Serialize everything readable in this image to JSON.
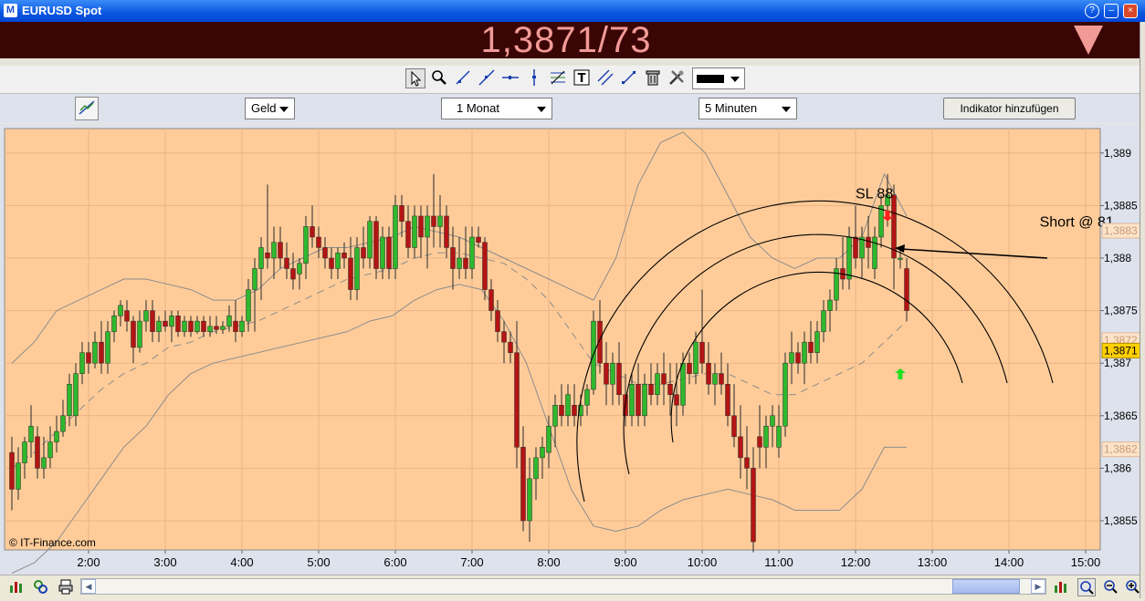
{
  "window": {
    "app_icon": "M",
    "title": "EURUSD Spot",
    "help_icon": "?",
    "minimize_icon": "–",
    "close_icon": "×"
  },
  "price": {
    "value": "1,3871/73",
    "direction": "down",
    "color": "#f19a96",
    "background": "#3a0505"
  },
  "toolbar": {
    "tools": [
      "select-pointer-icon",
      "zoom-icon",
      "trend-line-icon",
      "line-icon",
      "horizontal-line-icon",
      "vertical-line-icon",
      "fibonacci-icon",
      "text-icon",
      "parallel-lines-icon",
      "channel-icon",
      "trash-icon",
      "tools-icon"
    ],
    "color": "#000000"
  },
  "controls": {
    "price_type": "Geld",
    "period": "1 Monat",
    "interval": "5 Minuten",
    "add_indicator": "Indikator hinzufügen"
  },
  "chart_data": {
    "type": "candlestick",
    "background": "#ffcc99",
    "x_ticks": [
      "2:00",
      "3:00",
      "4:00",
      "5:00",
      "6:00",
      "7:00",
      "8:00",
      "9:00",
      "10:00",
      "11:00",
      "12:00",
      "13:00",
      "14:00",
      "15:00"
    ],
    "y_ticks": [
      "1,389",
      "1,3885",
      "1,388",
      "1,3875",
      "1,387",
      "1,3865",
      "1,386",
      "1,3855"
    ],
    "ylim": [
      1.3852,
      1.3894
    ],
    "price_tags": [
      {
        "label": "1,3883",
        "value": 1.38826,
        "style": "faded"
      },
      {
        "label": "1,3872",
        "value": 1.38722,
        "style": "faded"
      },
      {
        "label": "1,3871",
        "value": 1.38712,
        "style": "current"
      },
      {
        "label": "1,3862",
        "value": 1.38618,
        "style": "faded"
      }
    ],
    "annotations": [
      {
        "text": "SL 88",
        "x": "12:00",
        "y": 1.38857
      },
      {
        "text": "Short @ 81",
        "x": "14:24",
        "y": 1.3883
      }
    ],
    "copyright": "© IT-Finance.com",
    "bullish_color": "#2eb82e",
    "bearish_color": "#b41414",
    "candles": [
      [
        1.38615,
        1.3863,
        1.3856,
        1.3858
      ],
      [
        1.3858,
        1.3862,
        1.3857,
        1.38605
      ],
      [
        1.38605,
        1.3863,
        1.3859,
        1.38625
      ],
      [
        1.38625,
        1.3866,
        1.3861,
        1.3864
      ],
      [
        1.3863,
        1.3864,
        1.3859,
        1.386
      ],
      [
        1.386,
        1.3863,
        1.3859,
        1.3861
      ],
      [
        1.3861,
        1.3864,
        1.386,
        1.38625
      ],
      [
        1.38625,
        1.3865,
        1.38615,
        1.38635
      ],
      [
        1.38635,
        1.38665,
        1.3863,
        1.3865
      ],
      [
        1.3865,
        1.3869,
        1.3864,
        1.3868
      ],
      [
        1.3865,
        1.387,
        1.3864,
        1.3869
      ],
      [
        1.3869,
        1.3872,
        1.3868,
        1.3871
      ],
      [
        1.3871,
        1.3872,
        1.3869,
        1.387
      ],
      [
        1.387,
        1.3873,
        1.38695,
        1.3872
      ],
      [
        1.3872,
        1.3874,
        1.3869,
        1.387
      ],
      [
        1.387,
        1.3874,
        1.3869,
        1.3873
      ],
      [
        1.3873,
        1.3875,
        1.3872,
        1.38745
      ],
      [
        1.38745,
        1.3876,
        1.38735,
        1.38755
      ],
      [
        1.3875,
        1.3876,
        1.3873,
        1.3874
      ],
      [
        1.3874,
        1.38745,
        1.387,
        1.38715
      ],
      [
        1.38715,
        1.3875,
        1.3871,
        1.3874
      ],
      [
        1.3874,
        1.3876,
        1.3873,
        1.3875
      ],
      [
        1.3875,
        1.3876,
        1.3872,
        1.3873
      ],
      [
        1.3873,
        1.38745,
        1.3872,
        1.3874
      ],
      [
        1.3874,
        1.3875,
        1.3873,
        1.38735
      ],
      [
        1.38735,
        1.3875,
        1.3872,
        1.38745
      ],
      [
        1.38745,
        1.3875,
        1.38725,
        1.3873
      ],
      [
        1.3873,
        1.38745,
        1.38725,
        1.3874
      ],
      [
        1.3874,
        1.38745,
        1.38725,
        1.3873
      ],
      [
        1.3873,
        1.38745,
        1.38728,
        1.3874
      ],
      [
        1.3874,
        1.38745,
        1.38725,
        1.3873
      ],
      [
        1.3873,
        1.38745,
        1.38725,
        1.38735
      ],
      [
        1.38735,
        1.38745,
        1.38728,
        1.38732
      ],
      [
        1.38732,
        1.3874,
        1.38728,
        1.38735
      ],
      [
        1.38735,
        1.38755,
        1.3873,
        1.38745
      ],
      [
        1.3874,
        1.3876,
        1.3872,
        1.3873
      ],
      [
        1.3873,
        1.38745,
        1.38725,
        1.3874
      ],
      [
        1.3874,
        1.3878,
        1.3873,
        1.3877
      ],
      [
        1.3877,
        1.388,
        1.3873,
        1.3879
      ],
      [
        1.3879,
        1.3882,
        1.3876,
        1.3881
      ],
      [
        1.38805,
        1.3887,
        1.3879,
        1.388
      ],
      [
        1.388,
        1.3883,
        1.3878,
        1.38815
      ],
      [
        1.38815,
        1.3883,
        1.3879,
        1.388
      ],
      [
        1.388,
        1.38815,
        1.3878,
        1.3879
      ],
      [
        1.3879,
        1.38805,
        1.3877,
        1.3878
      ],
      [
        1.38785,
        1.388,
        1.3877,
        1.38795
      ],
      [
        1.38795,
        1.3884,
        1.3878,
        1.3883
      ],
      [
        1.3883,
        1.3885,
        1.3881,
        1.3882
      ],
      [
        1.3882,
        1.3883,
        1.388,
        1.3881
      ],
      [
        1.3881,
        1.3882,
        1.3879,
        1.388
      ],
      [
        1.388,
        1.3881,
        1.3878,
        1.3879
      ],
      [
        1.3879,
        1.3881,
        1.3878,
        1.38805
      ],
      [
        1.38805,
        1.38815,
        1.3879,
        1.388
      ],
      [
        1.388,
        1.3882,
        1.3876,
        1.3877
      ],
      [
        1.3877,
        1.3882,
        1.3876,
        1.3881
      ],
      [
        1.3881,
        1.3883,
        1.3879,
        1.388
      ],
      [
        1.388,
        1.3884,
        1.3879,
        1.38835
      ],
      [
        1.38835,
        1.3884,
        1.3878,
        1.3879
      ],
      [
        1.3879,
        1.3883,
        1.3878,
        1.3882
      ],
      [
        1.3882,
        1.3883,
        1.3878,
        1.3879
      ],
      [
        1.3879,
        1.3886,
        1.3878,
        1.3885
      ],
      [
        1.3885,
        1.3886,
        1.3882,
        1.38835
      ],
      [
        1.38835,
        1.3885,
        1.388,
        1.3881
      ],
      [
        1.3881,
        1.3885,
        1.388,
        1.3884
      ],
      [
        1.3884,
        1.3885,
        1.388,
        1.3882
      ],
      [
        1.3882,
        1.3885,
        1.3879,
        1.3884
      ],
      [
        1.3884,
        1.3888,
        1.3881,
        1.3883
      ],
      [
        1.3883,
        1.3886,
        1.3881,
        1.3884
      ],
      [
        1.3884,
        1.3885,
        1.388,
        1.3881
      ],
      [
        1.3881,
        1.3883,
        1.3877,
        1.3879
      ],
      [
        1.3879,
        1.3882,
        1.3878,
        1.388
      ],
      [
        1.388,
        1.3883,
        1.3878,
        1.3879
      ],
      [
        1.3879,
        1.3883,
        1.3878,
        1.3882
      ],
      [
        1.3882,
        1.3883,
        1.3881,
        1.38815
      ],
      [
        1.38815,
        1.3882,
        1.3876,
        1.3877
      ],
      [
        1.3877,
        1.3878,
        1.3874,
        1.3875
      ],
      [
        1.3875,
        1.3876,
        1.3872,
        1.3873
      ],
      [
        1.3873,
        1.3874,
        1.387,
        1.3872
      ],
      [
        1.3872,
        1.3873,
        1.387,
        1.3871
      ],
      [
        1.3871,
        1.3874,
        1.386,
        1.3862
      ],
      [
        1.3862,
        1.3864,
        1.3854,
        1.3855
      ],
      [
        1.3855,
        1.3861,
        1.3853,
        1.3859
      ],
      [
        1.3859,
        1.3862,
        1.3857,
        1.3861
      ],
      [
        1.3861,
        1.3863,
        1.3859,
        1.3862
      ],
      [
        1.38615,
        1.3865,
        1.386,
        1.3864
      ],
      [
        1.3864,
        1.3867,
        1.3862,
        1.3866
      ],
      [
        1.3866,
        1.3868,
        1.3864,
        1.3865
      ],
      [
        1.3865,
        1.3868,
        1.3864,
        1.3867
      ],
      [
        1.3866,
        1.3868,
        1.3864,
        1.3865
      ],
      [
        1.3865,
        1.3867,
        1.3864,
        1.3866
      ],
      [
        1.3866,
        1.3868,
        1.3865,
        1.38675
      ],
      [
        1.38675,
        1.3875,
        1.3867,
        1.3874
      ],
      [
        1.3874,
        1.3876,
        1.3869,
        1.387
      ],
      [
        1.387,
        1.3872,
        1.3866,
        1.3868
      ],
      [
        1.3868,
        1.3871,
        1.3866,
        1.387
      ],
      [
        1.387,
        1.3872,
        1.3866,
        1.3867
      ],
      [
        1.3867,
        1.3869,
        1.3864,
        1.3865
      ],
      [
        1.3865,
        1.3869,
        1.3864,
        1.3868
      ],
      [
        1.3868,
        1.387,
        1.3864,
        1.3865
      ],
      [
        1.3865,
        1.3869,
        1.3864,
        1.3868
      ],
      [
        1.3868,
        1.387,
        1.3866,
        1.3867
      ],
      [
        1.3867,
        1.387,
        1.3866,
        1.3869
      ],
      [
        1.3869,
        1.3871,
        1.3866,
        1.3868
      ],
      [
        1.3868,
        1.387,
        1.3865,
        1.3867
      ],
      [
        1.3867,
        1.387,
        1.3864,
        1.3866
      ],
      [
        1.3866,
        1.3871,
        1.3865,
        1.387
      ],
      [
        1.387,
        1.3871,
        1.3868,
        1.3869
      ],
      [
        1.3869,
        1.3873,
        1.3868,
        1.3872
      ],
      [
        1.3872,
        1.3877,
        1.3869,
        1.387
      ],
      [
        1.387,
        1.3872,
        1.3867,
        1.3868
      ],
      [
        1.3868,
        1.387,
        1.3866,
        1.3869
      ],
      [
        1.3869,
        1.3871,
        1.3867,
        1.3868
      ],
      [
        1.3868,
        1.387,
        1.3864,
        1.3865
      ],
      [
        1.3865,
        1.3868,
        1.3862,
        1.3863
      ],
      [
        1.3863,
        1.3866,
        1.3859,
        1.3861
      ],
      [
        1.3861,
        1.3864,
        1.3858,
        1.386
      ],
      [
        1.386,
        1.3862,
        1.3852,
        1.3853
      ],
      [
        1.3863,
        1.3866,
        1.386,
        1.3862
      ],
      [
        1.3862,
        1.3865,
        1.386,
        1.3864
      ],
      [
        1.3864,
        1.3866,
        1.3862,
        1.3865
      ],
      [
        1.3862,
        1.3866,
        1.3861,
        1.3864
      ],
      [
        1.3864,
        1.3871,
        1.3863,
        1.387
      ],
      [
        1.387,
        1.3873,
        1.3868,
        1.3871
      ],
      [
        1.3871,
        1.3872,
        1.3869,
        1.387
      ],
      [
        1.387,
        1.3873,
        1.3868,
        1.3872
      ],
      [
        1.3872,
        1.3874,
        1.387,
        1.3871
      ],
      [
        1.3871,
        1.3874,
        1.387,
        1.3873
      ],
      [
        1.3873,
        1.3876,
        1.3872,
        1.3875
      ],
      [
        1.3875,
        1.3877,
        1.3873,
        1.3876
      ],
      [
        1.3876,
        1.388,
        1.3875,
        1.3879
      ],
      [
        1.3879,
        1.3882,
        1.3877,
        1.3878
      ],
      [
        1.3878,
        1.3883,
        1.3877,
        1.3882
      ],
      [
        1.3882,
        1.3885,
        1.3879,
        1.388
      ],
      [
        1.388,
        1.3883,
        1.3878,
        1.3882
      ],
      [
        1.3882,
        1.3884,
        1.3879,
        1.3881
      ],
      [
        1.3879,
        1.3883,
        1.3878,
        1.3882
      ],
      [
        1.3882,
        1.3886,
        1.3881,
        1.3885
      ],
      [
        1.3885,
        1.3888,
        1.3883,
        1.3886
      ],
      [
        1.3886,
        1.3887,
        1.3877,
        1.388
      ],
      [
        1.388,
        1.3881,
        1.3879,
        1.388
      ],
      [
        1.3879,
        1.388,
        1.3874,
        1.3875
      ]
    ],
    "bollinger_upper": [
      1.387,
      1.3872,
      1.3875,
      1.3876,
      1.3877,
      1.3878,
      1.3878,
      1.38775,
      1.3877,
      1.3876,
      1.3876,
      1.3877,
      1.3879,
      1.388,
      1.3881,
      1.3881,
      1.38815,
      1.3882,
      1.3883,
      1.38825,
      1.3882,
      1.3881,
      1.388,
      1.3879,
      1.3878,
      1.3877,
      1.3876,
      1.388,
      1.3887,
      1.3891,
      1.3892,
      1.389,
      1.3886,
      1.3882,
      1.388,
      1.3879,
      1.388,
      1.388,
      1.3882,
      1.3888,
      1.3884
    ],
    "bollinger_middle": [
      1.386,
      1.38615,
      1.38635,
      1.38655,
      1.38675,
      1.3869,
      1.387,
      1.38715,
      1.3872,
      1.3873,
      1.38735,
      1.3874,
      1.3875,
      1.3876,
      1.3877,
      1.3878,
      1.38785,
      1.3879,
      1.388,
      1.38805,
      1.38805,
      1.388,
      1.38795,
      1.3878,
      1.3876,
      1.3873,
      1.387,
      1.3869,
      1.3868,
      1.3868,
      1.38685,
      1.3869,
      1.3869,
      1.3868,
      1.3867,
      1.3867,
      1.3868,
      1.3869,
      1.387,
      1.3872,
      1.3874
    ],
    "bollinger_lower": [
      1.385,
      1.3851,
      1.3853,
      1.3856,
      1.3859,
      1.3862,
      1.3864,
      1.3867,
      1.3869,
      1.387,
      1.38705,
      1.3871,
      1.38715,
      1.3872,
      1.38725,
      1.3873,
      1.3874,
      1.38745,
      1.3876,
      1.3877,
      1.38775,
      1.3877,
      1.3874,
      1.387,
      1.3864,
      1.3858,
      1.38545,
      1.3854,
      1.38545,
      1.3856,
      1.3857,
      1.38575,
      1.3858,
      1.38575,
      1.3857,
      1.3856,
      1.3856,
      1.3856,
      1.3858,
      1.3862,
      1.3862
    ],
    "signals": [
      {
        "type": "sell",
        "x": "12:25",
        "y": 1.38835,
        "color": "#ff2020"
      },
      {
        "type": "buy",
        "x": "12:35",
        "y": 1.38695,
        "color": "#20e020"
      }
    ]
  },
  "bottom": {
    "icons": [
      "add-chart-icon",
      "settings-icon",
      "print-icon"
    ],
    "zoom_icons": [
      "zoom-fit-icon",
      "zoom-out-icon",
      "zoom-in-icon"
    ]
  }
}
